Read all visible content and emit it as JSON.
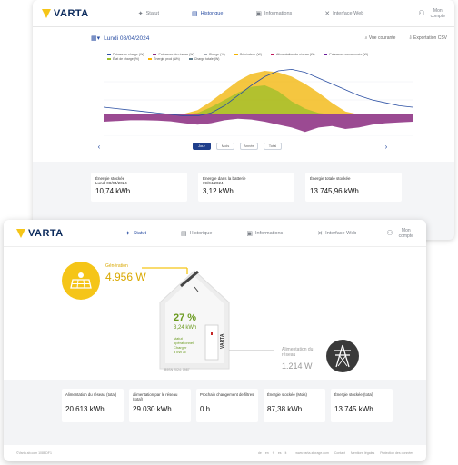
{
  "brand": "VARTA",
  "nav": [
    {
      "label": "Statut",
      "icon": "sun-icon"
    },
    {
      "label": "Historique",
      "icon": "chart-icon"
    },
    {
      "label": "Informations",
      "icon": "info-icon"
    },
    {
      "label": "Interface Web",
      "icon": "tools-icon"
    }
  ],
  "user": {
    "line1": "Mon",
    "line2": "compte"
  },
  "history": {
    "date": "Lundi 08/04/2024",
    "view_link": "Vue courante",
    "export_link": "Exportation CSV",
    "legend": [
      "Puissance charge (W)",
      "Puissance du réseau (W)",
      "Charge (%)",
      "Générateur (W)",
      "Alimentation du réseau (W)",
      "Puissance consommée (W)",
      "État de charge (%)",
      "Énergie prod (Wh)",
      "Charge totale (W)"
    ],
    "range_buttons": [
      "Jour",
      "Mois",
      "Année",
      "Total"
    ],
    "active_range": 0,
    "cards": [
      {
        "label": "Énergie stockée",
        "sub": "Lundi 08/04/2024",
        "value": "10,74 kWh"
      },
      {
        "label": "Énergie dans la batterie",
        "sub": "09/04/2024",
        "value": "3,12 kWh"
      },
      {
        "label": "Énergie totale stockée",
        "sub": "",
        "value": "13.745,96 kWh"
      }
    ],
    "colors": {
      "purple": "#8a2a7f",
      "yellow": "#f2b300",
      "green": "#9bbf2a",
      "blue": "#2b4fa3",
      "grey": "#a3a8b0"
    }
  },
  "chart_data": {
    "type": "area",
    "x": [
      0,
      1,
      2,
      3,
      4,
      5,
      6,
      7,
      8,
      9,
      10,
      11,
      12,
      13,
      14,
      15,
      16,
      17,
      18,
      19,
      20,
      21,
      22,
      23
    ],
    "series": [
      {
        "name": "Générateur (W)",
        "values": [
          0,
          0,
          0,
          0,
          0,
          0,
          50,
          300,
          900,
          1600,
          2300,
          2800,
          3000,
          2900,
          2600,
          2100,
          1500,
          800,
          200,
          0,
          0,
          0,
          0,
          0
        ]
      },
      {
        "name": "Puissance charge (W)",
        "values": [
          0,
          0,
          0,
          0,
          0,
          0,
          0,
          100,
          500,
          1000,
          1500,
          1900,
          2000,
          1600,
          900,
          400,
          100,
          0,
          0,
          0,
          0,
          0,
          0,
          0
        ]
      },
      {
        "name": "Puissance consommée (W)",
        "values": [
          -500,
          -450,
          -400,
          -400,
          -420,
          -480,
          -600,
          -700,
          -600,
          -400,
          -300,
          -350,
          -500,
          -700,
          -900,
          -1200,
          -900,
          -800,
          -1000,
          -900,
          -700,
          -600,
          -550,
          -500
        ]
      },
      {
        "name": "État de charge (%)",
        "values": [
          40,
          38,
          36,
          34,
          32,
          30,
          28,
          28,
          32,
          42,
          56,
          70,
          82,
          90,
          92,
          88,
          80,
          72,
          64,
          56,
          50,
          46,
          42,
          40
        ]
      }
    ],
    "ylim": [
      -1500,
      3500
    ]
  },
  "status": {
    "generation_label": "Génération",
    "generation_value": "4.956 W",
    "battery_pct": "27 %",
    "battery_kwh": "3,24 kWh",
    "battery_state": [
      "statut",
      "opérationnel",
      "Charger",
      "3 kW at"
    ],
    "serial": "B9SN 2024: 1987",
    "grid_label": "Alimentation du réseau",
    "grid_value": "1.214 W"
  },
  "stats": [
    {
      "label": "Alimentation du réseau (total)",
      "value": "20.613 kWh"
    },
    {
      "label": "alimentation par le réseau (total)",
      "value": "29.030 kWh"
    },
    {
      "label": "Prochain changement de filtres",
      "value": "0 h"
    },
    {
      "label": "Énergie stockée (Mois)",
      "value": "87,38 kWh"
    },
    {
      "label": "Énergie stockée (total)",
      "value": "13.745 kWh"
    }
  ],
  "footer": {
    "left": "©Varta ab.com 108EDF1",
    "langs": [
      "de",
      "en",
      "fr",
      "es",
      "it"
    ],
    "links": [
      "www.varta-storage.com",
      "Contact",
      "Mentions légales",
      "Protection des données"
    ]
  }
}
